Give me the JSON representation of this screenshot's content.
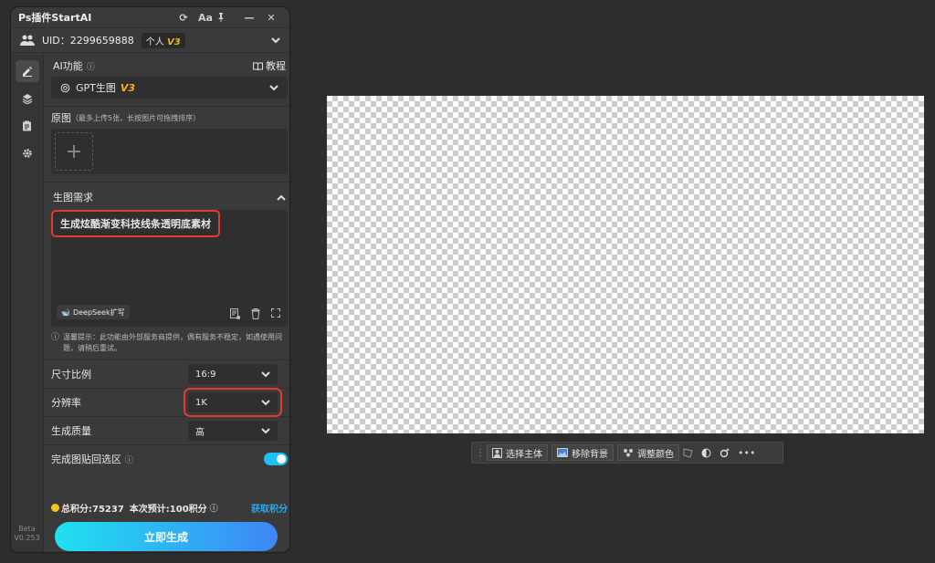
{
  "window": {
    "title": "Ps插件StartAI",
    "icons": [
      "refresh-icon",
      "font-size-icon",
      "pin-icon",
      "minimize-icon",
      "close-icon"
    ]
  },
  "account": {
    "uid": "UID：2299659888",
    "plan": "个人",
    "plan_version": "V3"
  },
  "sidebar": {
    "items": [
      "edit-icon",
      "layers-icon",
      "clipboard-icon",
      "gear-icon"
    ],
    "version_label": "Beta",
    "version_number": "V0.253"
  },
  "ai_function": {
    "label": "AI功能",
    "tutorial": "教程",
    "selected": "GPT生图",
    "selected_version": "V3"
  },
  "source_image": {
    "label": "原图",
    "hint": "（最多上传5张，长按图片可拖拽排序）"
  },
  "prompt_section": {
    "label": "生图需求",
    "prompt_text": "生成炫酷渐变科技线条透明底素材",
    "deepseek_button": "DeepSeek扩写",
    "warning": "温馨提示：此功能由外部服务商提供，偶有服务不稳定，如遇使用问题，请稍后重试。"
  },
  "settings": {
    "aspect_ratio": {
      "label": "尺寸比例",
      "value": "16:9"
    },
    "resolution": {
      "label": "分辨率",
      "value": "1K"
    },
    "quality": {
      "label": "生成质量",
      "value": "高"
    },
    "paste_back": {
      "label": "完成图贴回选区",
      "enabled": true
    }
  },
  "footer": {
    "total_credits": "总积分:75237",
    "estimate": "本次预计:100积分",
    "earn_link": "获取积分",
    "generate_button": "立即生成"
  },
  "context_bar": {
    "select_subject": "选择主体",
    "remove_background": "移除背景",
    "adjust_color": "调整颜色"
  },
  "colors": {
    "accent": "#1ec1f5",
    "highlight": "#e53935",
    "version_badge": "#f5b21e",
    "gradient_start": "#1fe1f0",
    "gradient_end": "#3e86f5"
  }
}
